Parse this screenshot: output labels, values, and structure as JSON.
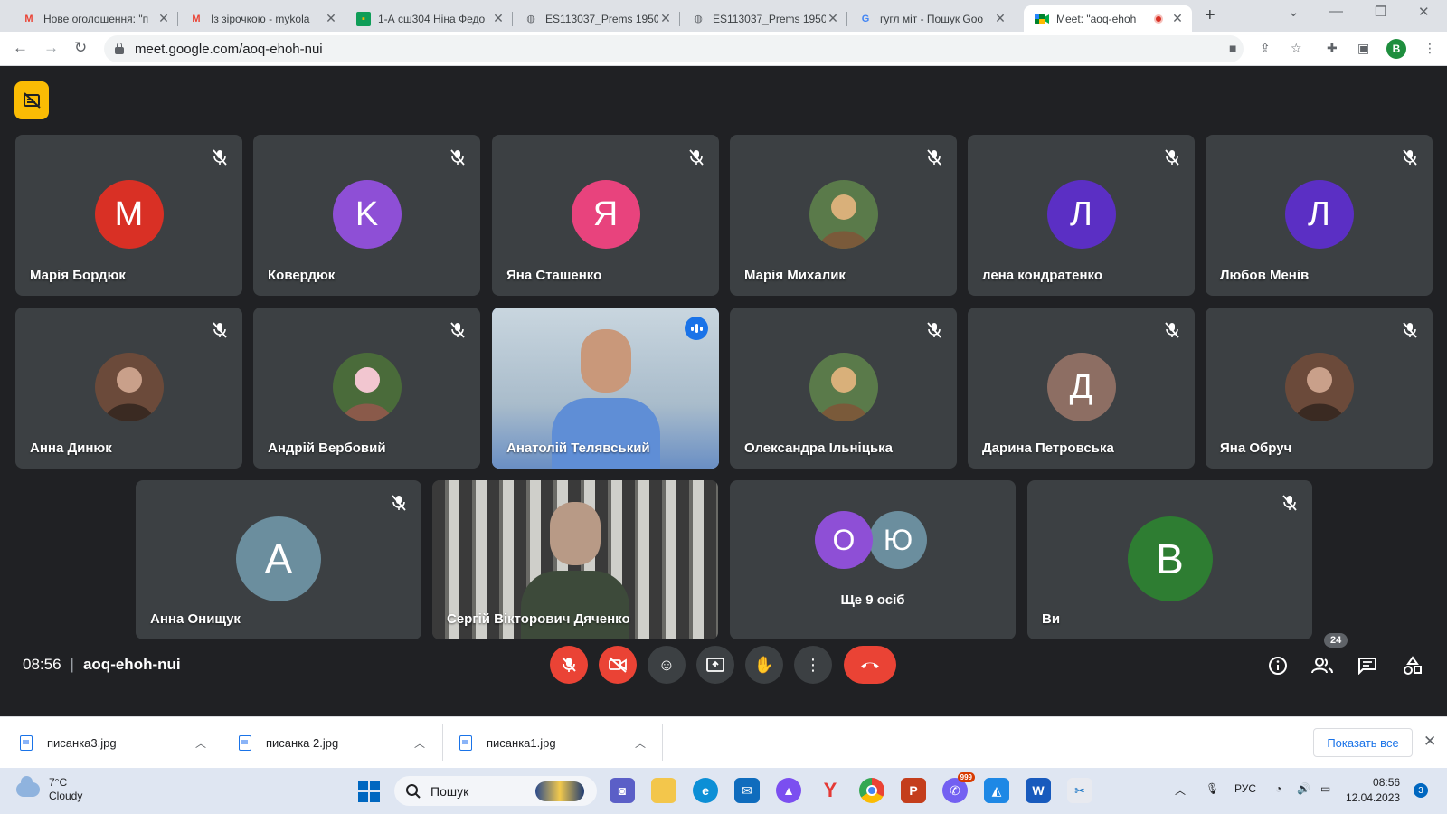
{
  "browser": {
    "tabs": [
      {
        "title": "Нове оголошення: \"п",
        "icon": "gmail-icon",
        "active": false
      },
      {
        "title": "Із зірочкою - mykola",
        "icon": "gmail-icon",
        "active": false
      },
      {
        "title": "1-А сш304 Ніна Федо",
        "icon": "classroom-icon",
        "active": false
      },
      {
        "title": "ES113037_Prems 1950",
        "icon": "globe-icon",
        "active": false
      },
      {
        "title": "ES113037_Prems 1950",
        "icon": "globe-icon",
        "active": false
      },
      {
        "title": "гугл міт - Пошук Goo",
        "icon": "google-icon",
        "active": false
      },
      {
        "title": "Meet: \"aoq-ehoh",
        "icon": "meet-icon",
        "active": true
      }
    ],
    "url": "meet.google.com/aoq-ehoh-nui",
    "profile_initial": "B"
  },
  "meet": {
    "time": "08:56",
    "meeting_code": "aoq-ehoh-nui",
    "participant_count": "24",
    "participants_row1": [
      {
        "name": "Марія Бордюк",
        "initial": "M",
        "color": "#d93025",
        "muted": true
      },
      {
        "name": "Ковердюк",
        "initial": "K",
        "color": "#8e4fd6",
        "muted": true
      },
      {
        "name": "Яна Сташенко",
        "initial": "Я",
        "color": "#e8437d",
        "muted": true
      },
      {
        "name": "Марія Михалик",
        "initial": "",
        "photo": true,
        "muted": true
      },
      {
        "name": "лена кондратенко",
        "initial": "Л",
        "color": "#5b2fc4",
        "muted": true
      },
      {
        "name": "Любов Менів",
        "initial": "Л",
        "color": "#5b2fc4",
        "muted": true
      }
    ],
    "participants_row2": [
      {
        "name": "Анна Динюк",
        "photo": true,
        "muted": true
      },
      {
        "name": "Андрій Вербовий",
        "photo": true,
        "muted": true
      },
      {
        "name": "Анатолій Телявський",
        "video": true,
        "speaking": true
      },
      {
        "name": "Олександра Ільніцька",
        "photo": true,
        "muted": true
      },
      {
        "name": "Дарина Петровська",
        "initial": "Д",
        "color": "#8d6e63",
        "muted": true
      },
      {
        "name": "Яна Обруч",
        "photo": true,
        "muted": true
      }
    ],
    "participants_row3": [
      {
        "name": "Анна Онищук",
        "initial": "A",
        "color": "#6b8e9e",
        "muted": true
      },
      {
        "name": "Сергій Вікторович Дяченко",
        "video": true
      },
      {
        "name": "",
        "more_label": "Ще 9 осіб",
        "initials": [
          "O",
          "Ю"
        ],
        "colors": [
          "#8e4fd6",
          "#6b8e9e"
        ]
      },
      {
        "name": "Ви",
        "initial": "B",
        "color": "#2e7d32",
        "muted": true
      }
    ]
  },
  "downloads": {
    "items": [
      "писанка3.jpg",
      "писанка 2.jpg",
      "писанка1.jpg"
    ],
    "show_all": "Показать все"
  },
  "taskbar": {
    "temperature": "7°C",
    "weather": "Cloudy",
    "search_placeholder": "Пошук",
    "language": "РУС",
    "time": "08:56",
    "date": "12.04.2023",
    "notifications": "3",
    "viber_badge": "999"
  }
}
